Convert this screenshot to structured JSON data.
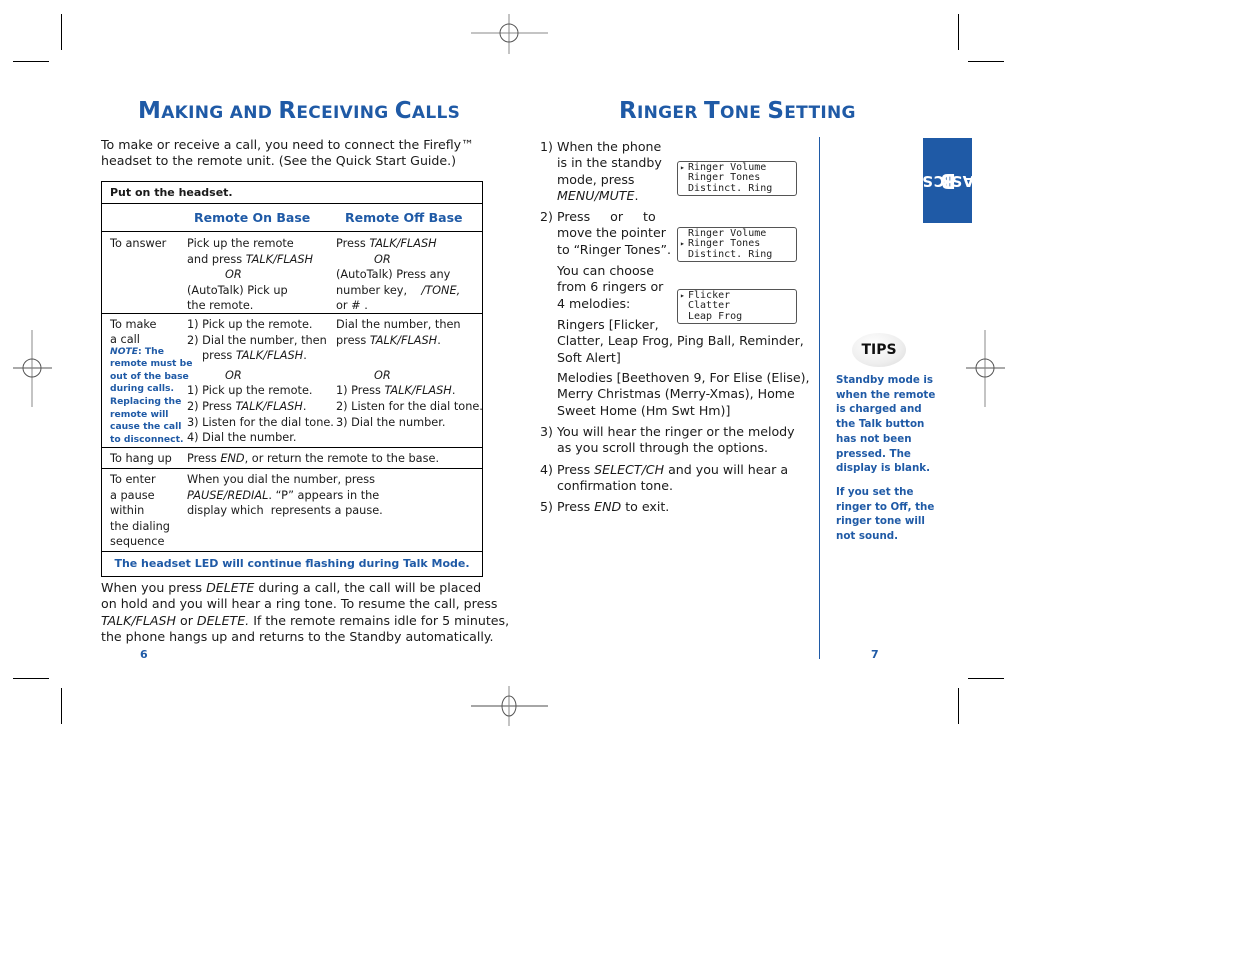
{
  "left_page": {
    "title": {
      "first": [
        "M",
        "AKING AND "
      ],
      "second": [
        "R",
        "ECEIVING "
      ],
      "third": [
        "C",
        "ALLS"
      ],
      "full": "Making and Receiving Calls"
    },
    "intro": [
      "To make or receive a call, you need to connect the Firefly™",
      "headset to the remote unit. (See the Quick Start Guide.)"
    ],
    "table": {
      "header": "Put on the headset.",
      "col_on_base": "Remote On Base",
      "col_off_base": "Remote Off Base",
      "rows": {
        "answer": {
          "label": "To answer",
          "on_base": [
            "Pick up the remote",
            "and press ",
            "TALK/FLASH",
            "OR",
            "(AutoTalk) Pick up",
            "the remote."
          ],
          "off_base": [
            "Press ",
            "TALK/FLASH",
            "OR",
            "(AutoTalk) Press any",
            "number key,    ",
            "/TONE,",
            "or # ."
          ]
        },
        "make": {
          "label": [
            "To make",
            "a call"
          ],
          "note": [
            "NOTE",
            ": The",
            "remote must be",
            "out of the base",
            "during calls.",
            "Replacing the",
            "remote will",
            "cause the call",
            "to disconnect."
          ],
          "on_base": [
            "1) Pick up the remote.",
            "2) Dial the number, then",
            "press ",
            "TALK/FLASH",
            ".",
            "OR",
            "1) Pick up the remote.",
            "2) Press ",
            "TALK/FLASH",
            ".",
            "3) Listen for the dial tone.",
            "4) Dial the number."
          ],
          "off_base": [
            "Dial the number, then",
            "press ",
            "TALK/FLASH",
            ".",
            "OR",
            "1) Press ",
            "TALK/FLASH",
            ".",
            "2) Listen for the dial tone.",
            "3) Dial the number."
          ]
        },
        "hangup": {
          "label": "To hang up",
          "text": [
            "Press ",
            "END",
            ", or return the remote to the base."
          ]
        },
        "pause": {
          "label": [
            "To enter",
            "a pause",
            "within",
            "the dialing",
            "sequence"
          ],
          "text": [
            "When you dial the number, press",
            "PAUSE/REDIAL",
            ". “P” appears in the",
            "display which  represents a pause."
          ]
        },
        "footer": "The headset LED will continue flashing during Talk Mode."
      }
    },
    "hold_paragraph": {
      "l1a": "When you press ",
      "l1b": "DELETE",
      "l1c": " during a call, the call will be placed",
      "l2": "on hold and you will hear a ring tone. To resume the call, press",
      "l3a": "TALK/FLASH",
      "l3b": " or ",
      "l3c": "DELETE.",
      "l3d": " If the remote remains idle for 5 minutes,",
      "l4": "the phone hangs up and returns to the Standby automatically."
    },
    "page_number": "6"
  },
  "right_page": {
    "title": {
      "first": [
        "R",
        "INGER "
      ],
      "second": [
        "T",
        "ONE "
      ],
      "third": [
        "S",
        "ETTING"
      ],
      "full": "Ringer Tone Setting"
    },
    "steps": {
      "s1": {
        "num": "1)",
        "lines": [
          "When the phone",
          "is in the standby",
          "mode, press",
          "MENU/MUTE",
          "."
        ]
      },
      "s2": {
        "num": "2)",
        "lines": [
          "Press     or     to",
          "move the pointer",
          "to “Ringer Tones”."
        ]
      },
      "choose": [
        "You can choose",
        "from 6 ringers or",
        "4 melodies:"
      ],
      "ringers": [
        "Ringers [Flicker,",
        "Clatter, Leap Frog, Ping Ball, Reminder,",
        "Soft Alert]"
      ],
      "melodies": [
        "Melodies [Beethoven 9, For Elise (Elise),",
        "Merry Christmas (Merry-Xmas), Home",
        "Sweet Home (Hm Swt Hm)]"
      ],
      "s3": {
        "num": "3)",
        "lines": [
          "You will hear the ringer or the melody",
          "as you scroll through the options."
        ]
      },
      "s4": {
        "num": "4)",
        "lines": [
          "Press ",
          "SELECT/CH",
          " and you will hear a",
          "confirmation tone."
        ]
      },
      "s5": {
        "num": "5)",
        "lines": [
          "Press ",
          "END",
          " to exit."
        ]
      }
    },
    "displays": [
      {
        "rows": [
          "Ringer Volume",
          "Ringer Tones",
          "Distinct. Ring"
        ],
        "pointer_row": 0
      },
      {
        "rows": [
          "Ringer Volume",
          "Ringer Tones",
          "Distinct. Ring"
        ],
        "pointer_row": 1
      },
      {
        "rows": [
          "Flicker",
          "Clatter",
          "Leap Frog"
        ],
        "pointer_row": 0
      }
    ],
    "pointer_glyph": "▸",
    "section_tab": {
      "first": "B",
      "rest": "ASICS",
      "full": "Basics"
    },
    "tips": {
      "badge": "TIPS",
      "tip1": [
        "Standby mode is",
        "when the remote",
        "is charged and",
        "the Talk button",
        "has not been",
        "pressed. The",
        "display is blank."
      ],
      "tip2": [
        "If you set the",
        "ringer to Off, the",
        "ringer tone will",
        "not sound."
      ]
    },
    "page_number": "7"
  },
  "colors": {
    "accent": "#1f5aa6",
    "text": "#1a1a1a",
    "rule": "#000000"
  }
}
